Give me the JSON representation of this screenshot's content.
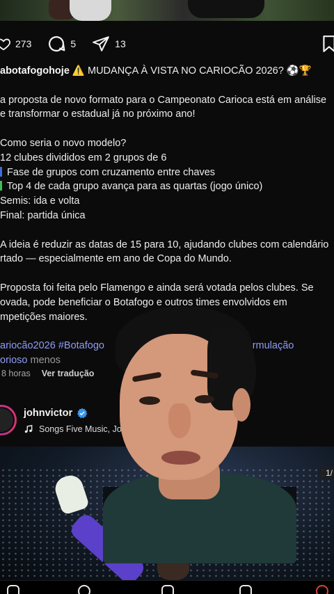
{
  "post": {
    "likes": "273",
    "comments": "5",
    "shares": "13",
    "caption": {
      "username": "abotafogohoje",
      "headline": " ⚠️ MUDANÇA À VISTA NO CARIOCÃO 2026? ⚽🏆",
      "intro_1": "a proposta de novo formato para o Campeonato Carioca está em análise",
      "intro_2": "e transformar o estadual já no próximo ano!",
      "question": "Como seria o novo modelo?",
      "bullet_1": " 12 clubes divididos em 2 grupos de 6",
      "bullet_2": " Fase de grupos com cruzamento entre chaves",
      "bullet_3": " Top 4 de cada grupo avança para as quartas (jogo único)",
      "bullet_4": " Semis: ida e volta",
      "bullet_5": " Final: partida única",
      "idea_1": "A ideia é reduzir as datas de 15 para 10, ajudando clubes com calendário",
      "idea_2": "rtado — especialmente em ano de Copa do Mundo.",
      "proposal_1": "Proposta foi feita pelo Flamengo e ainda será votada pelos clubes. Se",
      "proposal_2": "ovada, pode beneficiar o Botafogo e outros times envolvidos em",
      "proposal_3": "mpetições maiores.",
      "hashtags_1a": "ariocão2026 #Botafogo",
      "hashtags_1b": "#Reformulação",
      "hashtags_2": "orioso",
      "less": " menos"
    },
    "time_ago": "8 horas",
    "translate": "Ver tradução"
  },
  "next_post": {
    "username": "johnvictor",
    "music": "Songs Five Music, Jo",
    "slide_counter": "1/"
  },
  "colors": {
    "hashtag": "#8f9cf5",
    "verified": "#3897f0",
    "bullet_blue": "#3b6fe0",
    "bullet_green": "#3cbf5a"
  },
  "icons": [
    "heart-icon",
    "comment-icon",
    "share-icon",
    "bookmark-icon",
    "verified-icon",
    "music-note-icon"
  ]
}
